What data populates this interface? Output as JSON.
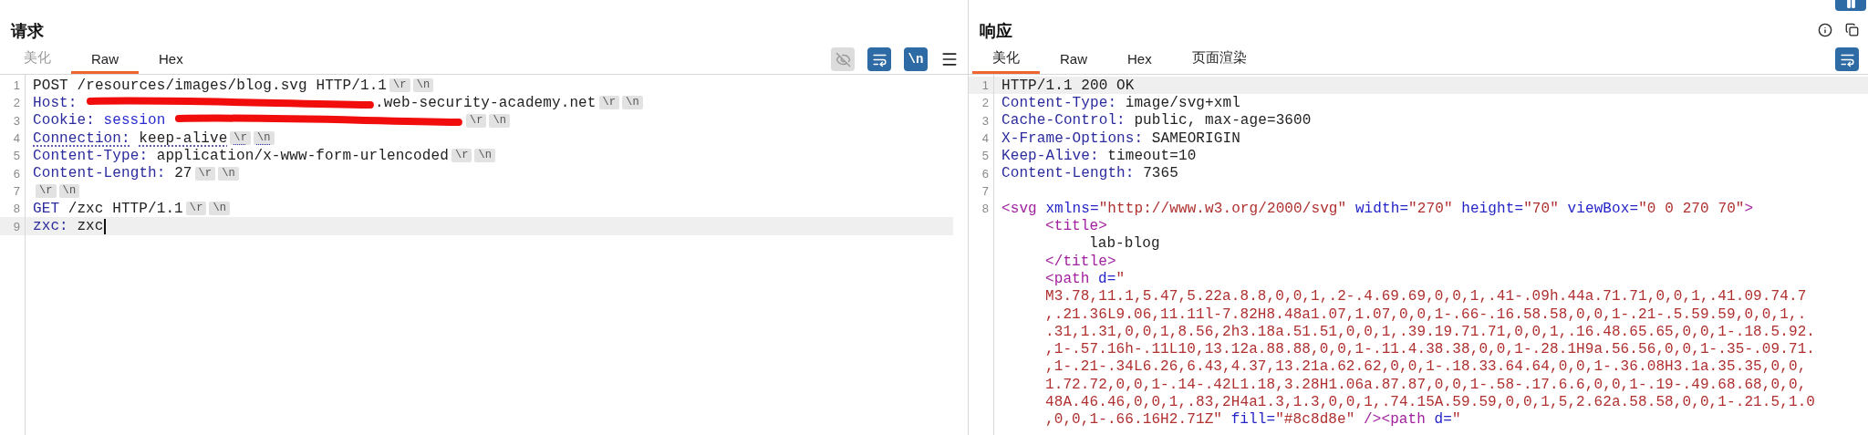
{
  "request": {
    "title": "请求",
    "tabs": [
      {
        "label": "美化",
        "selected": false,
        "disabled": true
      },
      {
        "label": "Raw",
        "selected": true,
        "disabled": false
      },
      {
        "label": "Hex",
        "selected": false,
        "disabled": false
      }
    ],
    "toolbar": [
      {
        "kind": "hide",
        "on": false
      },
      {
        "kind": "wrap",
        "on": true
      },
      {
        "kind": "newline",
        "label": "\\n",
        "on": true
      },
      {
        "kind": "menu"
      }
    ],
    "lines": [
      {
        "number": "1",
        "current": false,
        "segments": [
          {
            "kind": "plain",
            "text": "POST /resources/images/blog.svg HTTP/1.1"
          },
          {
            "kind": "crlf",
            "text": "\\r"
          },
          {
            "kind": "crlf",
            "text": "\\n"
          }
        ]
      },
      {
        "number": "2",
        "current": false,
        "segments": [
          {
            "kind": "name",
            "text": "Host:"
          },
          {
            "kind": "redacted"
          },
          {
            "kind": "plain",
            "text": ".web-security-academy.net"
          },
          {
            "kind": "crlf",
            "text": "\\r"
          },
          {
            "kind": "crlf",
            "text": "\\n"
          }
        ]
      },
      {
        "number": "3",
        "current": false,
        "segments": [
          {
            "kind": "name",
            "text": "Cookie:"
          },
          {
            "kind": "param",
            "text": "session"
          },
          {
            "kind": "redacted"
          },
          {
            "kind": "crlf",
            "text": "\\r"
          },
          {
            "kind": "crlf",
            "text": "\\n"
          }
        ]
      },
      {
        "number": "4",
        "current": false,
        "underlined": true,
        "segments": [
          {
            "kind": "name",
            "text": "Connection:"
          },
          {
            "kind": "plain",
            "text": "keep-alive"
          },
          {
            "kind": "crlf",
            "text": "\\r"
          },
          {
            "kind": "crlf",
            "text": "\\n"
          }
        ]
      },
      {
        "number": "5",
        "current": false,
        "segments": [
          {
            "kind": "name",
            "text": "Content-Type:"
          },
          {
            "kind": "plain",
            "text": "application/x-www-form-urlencoded"
          },
          {
            "kind": "crlf",
            "text": "\\r"
          },
          {
            "kind": "crlf",
            "text": "\\n"
          }
        ]
      },
      {
        "number": "6",
        "current": false,
        "segments": [
          {
            "kind": "name",
            "text": "Content-Length:"
          },
          {
            "kind": "plain",
            "text": "27"
          },
          {
            "kind": "crlf",
            "text": "\\r"
          },
          {
            "kind": "crlf",
            "text": "\\n"
          }
        ]
      },
      {
        "number": "7",
        "current": false,
        "segments": [
          {
            "kind": "crlf",
            "text": "\\r"
          },
          {
            "kind": "crlf",
            "text": "\\n"
          }
        ]
      },
      {
        "number": "8",
        "current": false,
        "segments": [
          {
            "kind": "name",
            "text": "GET"
          },
          {
            "kind": "plain",
            "text": "/zxc HTTP/1.1"
          },
          {
            "kind": "crlf",
            "text": "\\r"
          },
          {
            "kind": "crlf",
            "text": "\\n"
          }
        ]
      },
      {
        "number": "9",
        "current": true,
        "segments": [
          {
            "kind": "name",
            "text": "zxc:"
          },
          {
            "kind": "plain",
            "text": "zxc"
          },
          {
            "kind": "cursor"
          }
        ]
      }
    ]
  },
  "response": {
    "title": "响应",
    "tabs": [
      {
        "label": "美化",
        "selected": true,
        "disabled": false
      },
      {
        "label": "Raw",
        "selected": false,
        "disabled": false
      },
      {
        "label": "Hex",
        "selected": false,
        "disabled": false
      },
      {
        "label": "页面渲染",
        "selected": false,
        "disabled": false
      }
    ],
    "header_icons": [
      {
        "kind": "info"
      },
      {
        "kind": "popout"
      }
    ],
    "toolbar": [
      {
        "kind": "wrap",
        "on": true
      }
    ],
    "pause": {
      "on": true
    },
    "lines": [
      {
        "number": "1",
        "current": true,
        "segments": [
          {
            "kind": "plain",
            "text": "HTTP/1.1 200 OK"
          }
        ]
      },
      {
        "number": "2",
        "current": false,
        "segments": [
          {
            "kind": "name",
            "text": "Content-Type:"
          },
          {
            "kind": "plain",
            "text": "image/svg+xml"
          }
        ]
      },
      {
        "number": "3",
        "current": false,
        "segments": [
          {
            "kind": "name",
            "text": "Cache-Control:"
          },
          {
            "kind": "plain",
            "text": "public, max-age=3600"
          }
        ]
      },
      {
        "number": "4",
        "current": false,
        "segments": [
          {
            "kind": "name",
            "text": "X-Frame-Options:"
          },
          {
            "kind": "plain",
            "text": "SAMEORIGIN"
          }
        ]
      },
      {
        "number": "5",
        "current": false,
        "segments": [
          {
            "kind": "name",
            "text": "Keep-Alive:"
          },
          {
            "kind": "plain",
            "text": "timeout=10"
          }
        ]
      },
      {
        "number": "6",
        "current": false,
        "segments": [
          {
            "kind": "name",
            "text": "Content-Length:"
          },
          {
            "kind": "plain",
            "text": "7365"
          }
        ]
      },
      {
        "number": "7",
        "current": false
      },
      {
        "number": "8",
        "current": false,
        "segments": [
          {
            "kind": "tag",
            "text": "<svg"
          },
          {
            "kind": "attr",
            "text": "xmlns="
          },
          {
            "kind": "string",
            "text": "\"http://www.w3.org/2000/svg\""
          },
          {
            "kind": "attr",
            "text": "width="
          },
          {
            "kind": "string",
            "text": "\"270\""
          },
          {
            "kind": "attr",
            "text": "height="
          },
          {
            "kind": "string",
            "text": "\"70\""
          },
          {
            "kind": "attr",
            "text": "viewBox="
          },
          {
            "kind": "string",
            "text": "\"0 0 270 70\""
          },
          {
            "kind": "tag",
            "text": ">"
          }
        ],
        "children": [
          {
            "segments": [
              {
                "kind": "tag",
                "text": "<title>"
              }
            ],
            "children": [
              {
                "segments": [
                  {
                    "kind": "plain",
                    "text": "lab-blog"
                  }
                ]
              }
            ]
          },
          {
            "segments": [
              {
                "kind": "tag",
                "text": "</title>"
              }
            ]
          },
          {
            "segments": [
              {
                "kind": "tag",
                "text": "<path"
              },
              {
                "kind": "attr",
                "text": "d="
              },
              {
                "kind": "string",
                "text": "\""
              }
            ]
          },
          {
            "segments": [
              {
                "kind": "string",
                "text": "M3.78,11.1,5.47,5.22a.8.8,0,0,1,.2-.4.69.69,0,0,1,.41-.09h.44a.71.71,0,0,1,.41.09.74.7"
              }
            ]
          },
          {
            "segments": [
              {
                "kind": "string",
                "text": ",.21.36L9.06,11.11l-7.82H8.48a1.07,1.07,0,0,1-.66-.16.58.58,0,0,1-.21-.5.59.59,0,0,1,."
              }
            ]
          },
          {
            "segments": [
              {
                "kind": "string",
                "text": ".31,1.31,0,0,1,8.56,2h3.18a.51.51,0,0,1,.39.19.71.71,0,0,1,.16.48.65.65,0,0,1-.18.5.92."
              }
            ]
          },
          {
            "segments": [
              {
                "kind": "string",
                "text": ",1-.57.16h-.11L10,13.12a.88.88,0,0,1-.11.4.38.38,0,0,1-.28.1H9a.56.56,0,0,1-.35-.09.71."
              }
            ]
          },
          {
            "segments": [
              {
                "kind": "string",
                "text": ",1-.21-.34L6.26,6.43,4.37,13.21a.62.62,0,0,1-.18.33.64.64,0,0,1-.36.08H3.1a.35.35,0,0,"
              }
            ]
          },
          {
            "segments": [
              {
                "kind": "string",
                "text": "1.72.72,0,0,1-.14-.42L1.18,3.28H1.06a.87.87,0,0,1-.58-.17.6.6,0,0,1-.19-.49.68.68,0,0,"
              }
            ]
          },
          {
            "segments": [
              {
                "kind": "string",
                "text": "48A.46.46,0,0,1,.83,2H4a1.3,1.3,0,0,1,.74.15A.59.59,0,0,1,5,2.62a.58.58,0,0,1-.21.5,1.0"
              }
            ]
          },
          {
            "segments": [
              {
                "kind": "string",
                "text": ",0,0,1-.66.16H2.71Z\""
              },
              {
                "kind": "attr",
                "text": "fill="
              },
              {
                "kind": "string",
                "text": "\"#8c8d8e\""
              },
              {
                "kind": "tag",
                "text": "/><path"
              },
              {
                "kind": "attr",
                "text": "d="
              },
              {
                "kind": "string",
                "text": "\""
              }
            ]
          }
        ]
      }
    ]
  }
}
